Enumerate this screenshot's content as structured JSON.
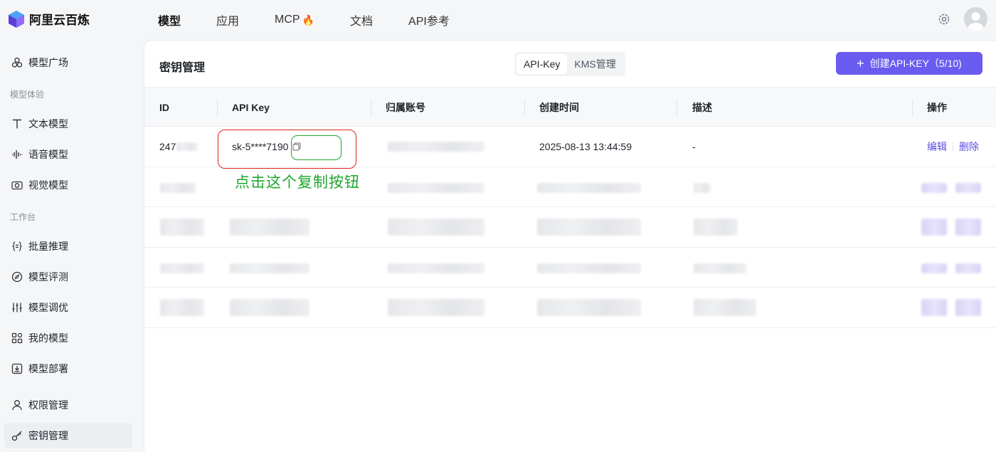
{
  "brand": {
    "name": "阿里云百炼"
  },
  "topnav": [
    {
      "label": "模型",
      "active": true
    },
    {
      "label": "应用",
      "active": false
    },
    {
      "label": "MCP",
      "active": false,
      "badge_icon": "fire-icon"
    },
    {
      "label": "文档",
      "active": false
    },
    {
      "label": "API参考",
      "active": false
    }
  ],
  "sidebar": {
    "items": [
      {
        "label": "模型广场",
        "icon": "model-square-icon"
      },
      {
        "label": "文本模型",
        "icon": "text-icon"
      },
      {
        "label": "语音模型",
        "icon": "waveform-icon"
      },
      {
        "label": "视觉模型",
        "icon": "camera-icon"
      },
      {
        "label": "批量推理",
        "icon": "braces-icon"
      },
      {
        "label": "模型评测",
        "icon": "compass-icon"
      },
      {
        "label": "模型调优",
        "icon": "sliders-icon"
      },
      {
        "label": "我的模型",
        "icon": "grid-icon"
      },
      {
        "label": "模型部署",
        "icon": "deploy-icon"
      },
      {
        "label": "权限管理",
        "icon": "user-icon"
      },
      {
        "label": "密钥管理",
        "icon": "key-icon",
        "active": true
      }
    ],
    "groups": [
      "模型体验",
      "工作台"
    ]
  },
  "page": {
    "title": "密钥管理",
    "tabs": [
      {
        "label": "API-Key",
        "active": true
      },
      {
        "label": "KMS管理",
        "active": false
      }
    ],
    "create_button": "创建API-KEY（5/10)"
  },
  "table": {
    "columns": [
      "ID",
      "API Key",
      "归属账号",
      "创建时间",
      "描述",
      "操作"
    ],
    "rows": [
      {
        "id": "247",
        "api_key": "sk-5****7190",
        "created": "2025-08-13 13:44:59",
        "desc": "-",
        "edit": "编辑",
        "delete": "删除"
      }
    ]
  },
  "annotation": {
    "note": "点击这个复制按钮"
  },
  "colors": {
    "accent": "#6a5cf0",
    "annotation_red": "#d9261c",
    "annotation_green": "#1ea52b"
  }
}
